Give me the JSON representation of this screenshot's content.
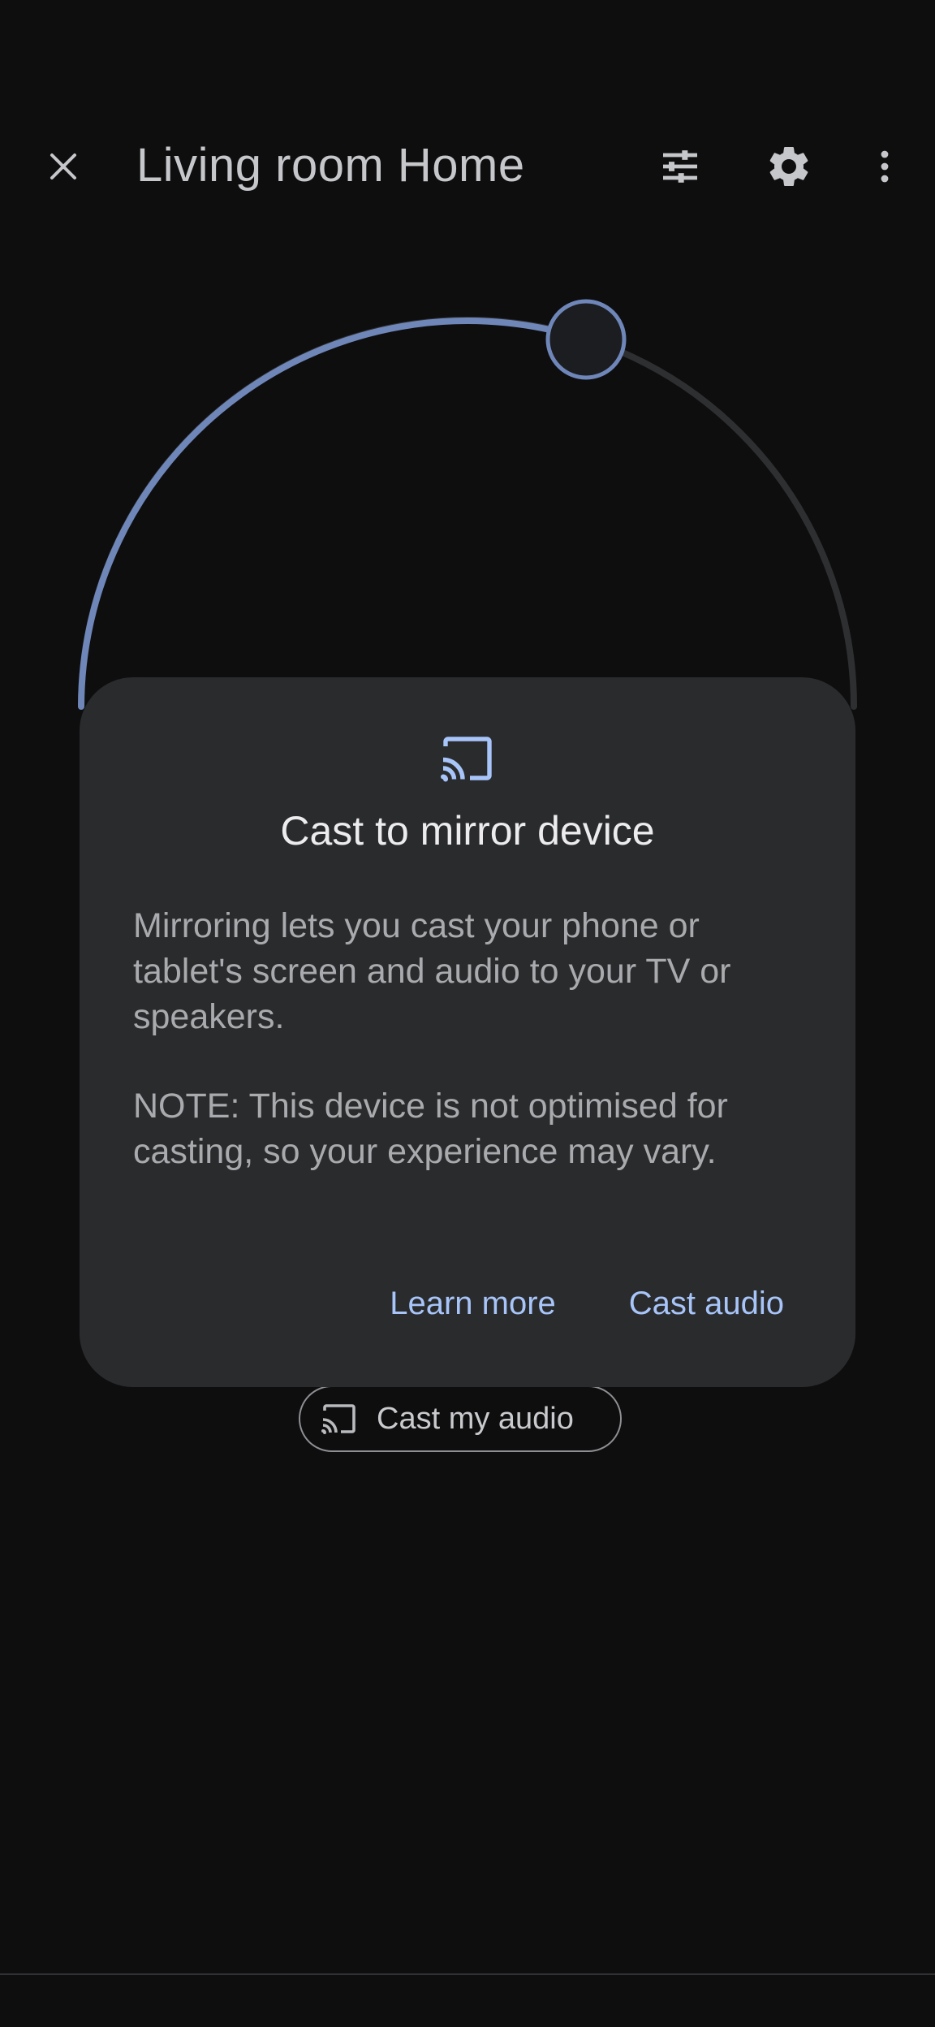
{
  "header": {
    "title": "Living room Home",
    "icons": [
      "close-icon",
      "tune-icon",
      "gear-icon",
      "more-vert-icon"
    ]
  },
  "volume": {
    "level_percent": 60
  },
  "cast_chip": {
    "label": "Cast my audio",
    "icon": "cast-icon"
  },
  "dialog": {
    "icon": "cast-icon",
    "title": "Cast to mirror device",
    "paragraph1": "Mirroring lets you cast your phone or tablet's screen and audio to your TV or speakers.",
    "paragraph2": "NOTE: This device is not optimised for casting, so your experience may vary.",
    "learn_more": "Learn more",
    "cast_audio": "Cast audio"
  },
  "colors": {
    "background": "#0e0e0f",
    "dialog": "#2a2b2d",
    "accent": "#a8c5fa",
    "dial_active": "#6f86b8",
    "dial_track": "#2e2f31"
  }
}
